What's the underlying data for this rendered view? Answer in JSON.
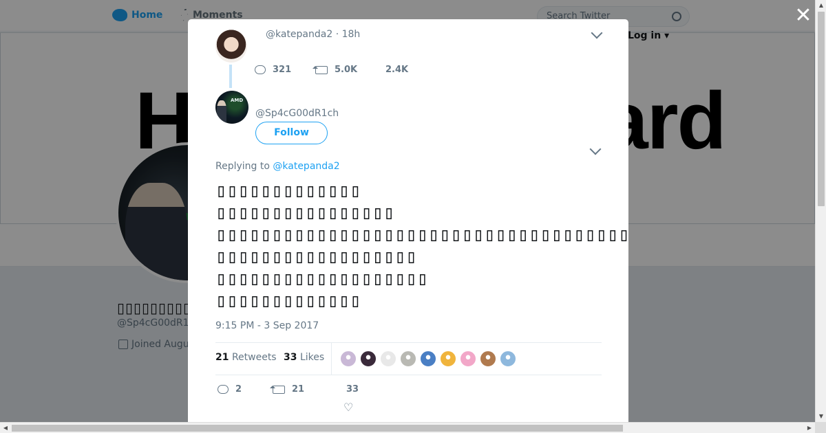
{
  "nav": {
    "home": "Home",
    "moments": "Moments",
    "search_placeholder": "Search Twitter",
    "login": "Log in ▾"
  },
  "background_profile": {
    "banner_left": "H",
    "banner_right": "ard",
    "display_name": "▯▯▯▯▯▯▯▯▯▯▯",
    "handle": "@Sp4cG00dR1",
    "joined": "Joined Augu"
  },
  "modal": {
    "close_glyph": "✕",
    "parent_tweet": {
      "handle_time": "@katepanda2 · 18h",
      "replies": "321",
      "retweets": "5.0K",
      "likes": "2.4K"
    },
    "author": {
      "handle": "@Sp4cG00dR1ch",
      "avatar_text": "AMD",
      "follow_label": "Follow"
    },
    "replying_prefix": "Replying to ",
    "replying_to": "@katepanda2",
    "text_lines": [
      "▯▯▯▯▯▯▯▯▯▯▯▯▯",
      "▯▯▯▯▯▯▯▯▯▯▯▯▯▯▯▯",
      "▯▯▯▯▯▯▯▯▯▯▯▯▯▯▯▯▯▯▯▯▯▯▯▯▯▯▯▯▯▯▯▯▯▯▯▯▯",
      "▯▯▯▯▯▯▯▯▯▯▯▯▯▯▯▯▯▯",
      "▯▯▯▯▯▯▯▯▯▯▯▯▯▯▯▯▯▯▯",
      "▯▯▯▯▯▯▯▯▯▯▯▯▯"
    ],
    "timestamp": "9:15 PM - 3 Sep 2017",
    "stats": {
      "retweets_count": "21",
      "retweets_label": "Retweets",
      "likes_count": "33",
      "likes_label": "Likes"
    },
    "liker_colors": [
      "#c9b8d6",
      "#3a2a3a",
      "#e8e8e8",
      "#b9b9b3",
      "#4a7fc4",
      "#f0b43c",
      "#f2a7c8",
      "#b07a4e",
      "#8eb8dd"
    ],
    "actions": {
      "replies": "2",
      "retweets": "21",
      "likes": "33"
    }
  },
  "colors": {
    "accent": "#1da1f2",
    "muted": "#657786"
  }
}
